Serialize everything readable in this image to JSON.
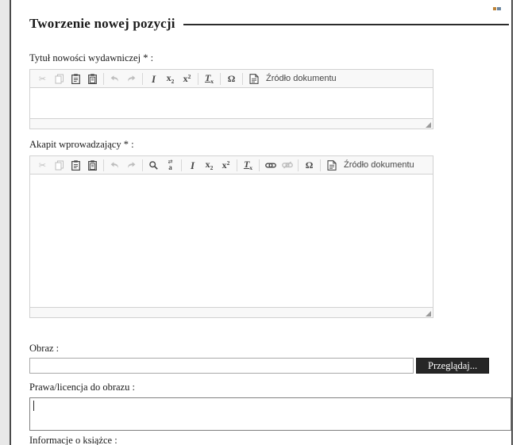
{
  "page": {
    "title": "Tworzenie nowej pozycji"
  },
  "form": {
    "title_field": {
      "label": "Tytuł nowości wydawniczej * :",
      "value": ""
    },
    "intro_field": {
      "label": "Akapit wprowadzający * :",
      "value": ""
    },
    "image_field": {
      "label": "Obraz :",
      "value": "",
      "browse_label": "Przeglądaj..."
    },
    "rights_field": {
      "label": "Prawa/licencja do obrazu :",
      "value": ""
    },
    "next_field": {
      "label": "Informacje o książce :"
    }
  },
  "toolbars": {
    "title_editor": [
      {
        "icon": "cut",
        "enabled": false
      },
      {
        "icon": "copy",
        "enabled": false
      },
      {
        "icon": "paste",
        "enabled": true
      },
      {
        "icon": "paste-from-word",
        "enabled": true
      },
      {
        "sep": true
      },
      {
        "icon": "undo",
        "enabled": false
      },
      {
        "icon": "redo",
        "enabled": false
      },
      {
        "sep": true
      },
      {
        "icon": "italic",
        "enabled": true
      },
      {
        "icon": "subscript",
        "enabled": true
      },
      {
        "icon": "superscript",
        "enabled": true
      },
      {
        "sep": true
      },
      {
        "icon": "remove-format",
        "enabled": true
      },
      {
        "sep": true
      },
      {
        "icon": "special-character",
        "enabled": true
      },
      {
        "sep": true
      },
      {
        "icon": "document-source",
        "enabled": true,
        "label": "Źródło dokumentu"
      }
    ],
    "intro_editor": [
      {
        "icon": "cut",
        "enabled": false
      },
      {
        "icon": "copy",
        "enabled": false
      },
      {
        "icon": "paste",
        "enabled": true
      },
      {
        "icon": "paste-from-word",
        "enabled": true
      },
      {
        "sep": true
      },
      {
        "icon": "undo",
        "enabled": false
      },
      {
        "icon": "redo",
        "enabled": false
      },
      {
        "sep": true
      },
      {
        "icon": "find",
        "enabled": true
      },
      {
        "icon": "replace",
        "enabled": true
      },
      {
        "sep": true
      },
      {
        "icon": "italic",
        "enabled": true
      },
      {
        "icon": "subscript",
        "enabled": true
      },
      {
        "icon": "superscript",
        "enabled": true
      },
      {
        "sep": true
      },
      {
        "icon": "remove-format",
        "enabled": true
      },
      {
        "sep": true
      },
      {
        "icon": "link",
        "enabled": true
      },
      {
        "icon": "unlink",
        "enabled": false
      },
      {
        "sep": true
      },
      {
        "icon": "special-character",
        "enabled": true
      },
      {
        "sep": true
      },
      {
        "icon": "document-source",
        "enabled": true,
        "label": "Źródło dokumentu"
      }
    ]
  },
  "colors": {
    "browse_button_bg": "#262626",
    "toolbar_bg": "#f8f8f8",
    "frame_border": "#4a4a4a",
    "editor_border": "#d1d1d1"
  }
}
